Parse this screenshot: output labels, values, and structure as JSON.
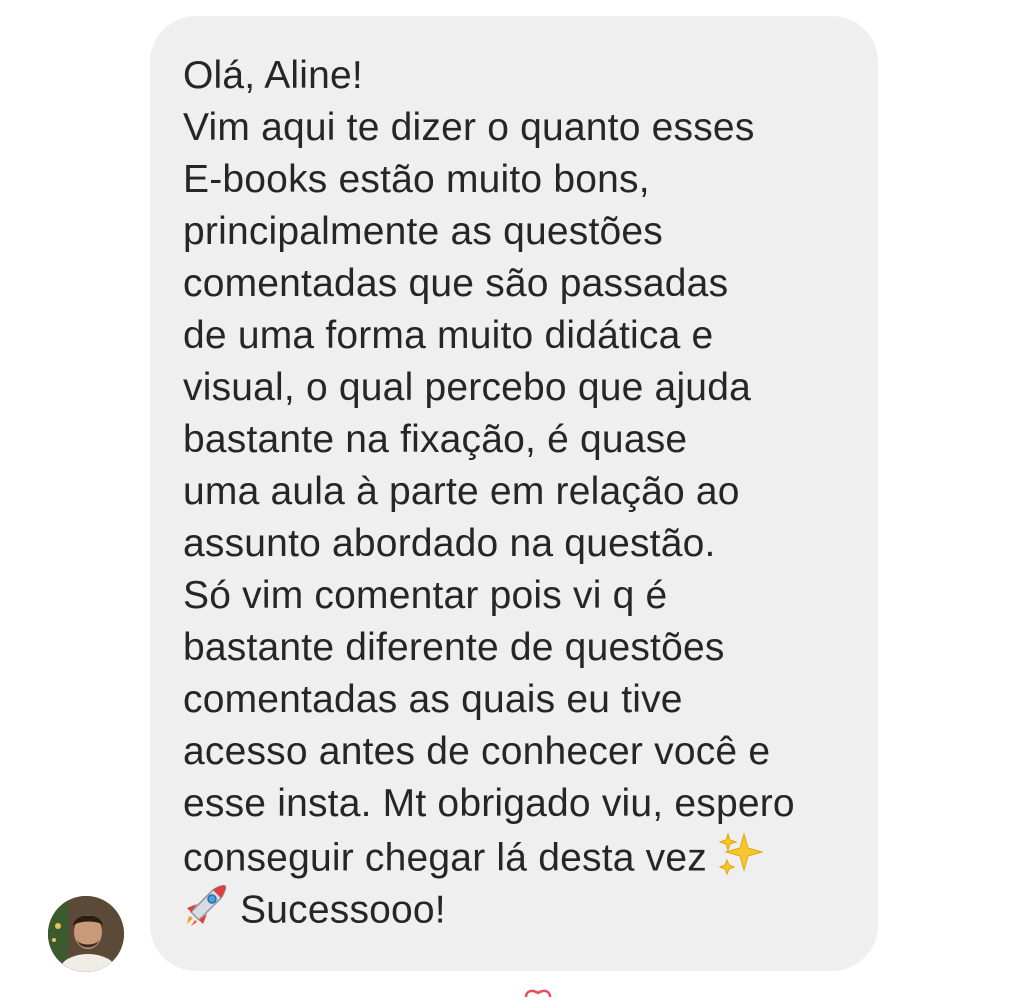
{
  "message": {
    "lines": [
      "Olá, Aline!",
      "Vim aqui te dizer o quanto esses",
      "E-books estão muito bons,",
      "principalmente as questões",
      "comentadas que são passadas",
      "de uma forma muito didática e",
      "visual, o qual percebo que ajuda",
      "bastante na fixação, é quase",
      "uma aula à parte em relação ao",
      "assunto abordado na questão.",
      "Só vim comentar pois vi q é",
      "bastante diferente de questões",
      "comentadas as quais eu tive",
      "acesso antes de conhecer você e",
      "esse insta. Mt obrigado viu, espero",
      "conseguir chegar lá desta vez",
      "Sucessooo!"
    ],
    "emojis": [
      "sparkles-icon",
      "rocket-icon"
    ]
  },
  "sender": {
    "avatar_icon": "avatar"
  },
  "colors": {
    "bubble": "#efefef",
    "text": "#262626",
    "reaction": "#ed4956"
  }
}
